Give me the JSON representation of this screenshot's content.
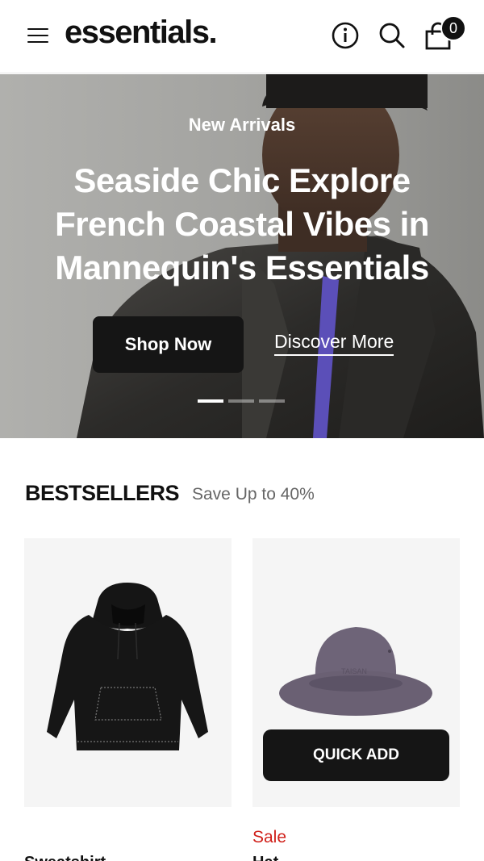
{
  "header": {
    "logo": "essentials.",
    "cart_count": "0",
    "icons": [
      "menu-icon",
      "info-icon",
      "search-icon",
      "shopping-bag-icon"
    ]
  },
  "hero": {
    "eyebrow": "New Arrivals",
    "title": "Seaside Chic Explore French Coastal Vibes in Mannequin's Essentials",
    "primary_button": "Shop Now",
    "secondary_link": "Discover More",
    "slides": 3,
    "active_slide": 1
  },
  "bestsellers": {
    "title": "BESTSELLERS",
    "subtitle": "Save Up to 40%",
    "products": [
      {
        "name": "Sweatshirt",
        "image": "black-hoodie",
        "sale_label": ""
      },
      {
        "name": "Hat",
        "image": "purple-bucket-hat",
        "sale_label": "Sale",
        "quick_add_label": "QUICK ADD"
      }
    ]
  },
  "colors": {
    "primary": "#151515",
    "sale": "#d0201a",
    "subtitle": "#666666"
  }
}
